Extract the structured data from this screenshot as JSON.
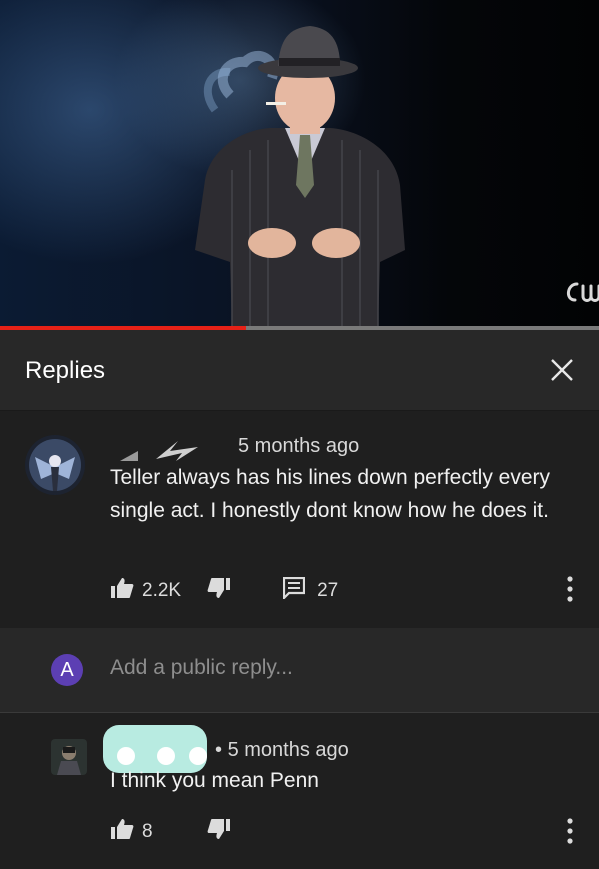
{
  "video": {
    "channel_logo": "cw",
    "progress": 0.41,
    "progress_color": "#e62117"
  },
  "replies_panel": {
    "title": "Replies",
    "close_icon": "close-icon"
  },
  "main_comment": {
    "time": "5 months ago",
    "text": "Teller always has his lines down perfectly every single act. I honestly dont know how he does it.",
    "likes": "2.2K",
    "replies_count": "27"
  },
  "reply_box": {
    "avatar_letter": "A",
    "placeholder": "Add a public reply..."
  },
  "reply_comment": {
    "time": "5 months ago",
    "text": "I think you mean Penn",
    "likes": "8"
  },
  "colors": {
    "panel": "#282828",
    "background": "#1f1f1f",
    "accent_avatar": "#5c3fb3",
    "redaction": "#b8ebe1"
  }
}
